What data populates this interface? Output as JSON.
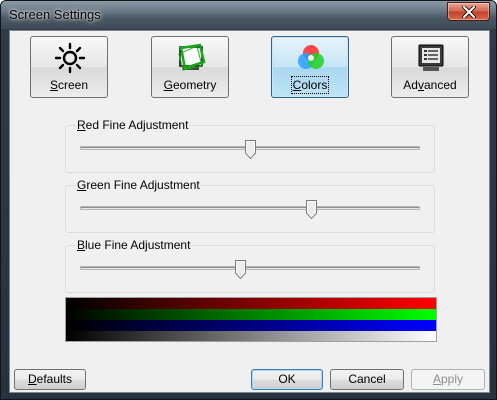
{
  "window": {
    "title": "Screen Settings"
  },
  "tabs": [
    {
      "label": "Screen",
      "mnemonic": "S",
      "rest": "creen",
      "icon": "sun-icon"
    },
    {
      "label": "Geometry",
      "mnemonic": "G",
      "rest": "eometry",
      "icon": "geometry-icon"
    },
    {
      "label": "Colors",
      "mnemonic": "C",
      "rest": "olors",
      "icon": "rgb-circles-icon",
      "active": true
    },
    {
      "label": "Advanced",
      "pre": "Ad",
      "mnemonic": "v",
      "rest": "anced",
      "icon": "monitor-settings-icon"
    }
  ],
  "sliders": {
    "red": {
      "label": "Red Fine Adjustment",
      "mnemonic": "R",
      "rest": "ed Fine Adjustment",
      "value": 0.5
    },
    "green": {
      "label": "Green Fine Adjustment",
      "mnemonic": "G",
      "rest": "reen Fine Adjustment",
      "value": 0.68
    },
    "blue": {
      "label": "Blue Fine Adjustment",
      "mnemonic": "B",
      "rest": "lue Fine Adjustment",
      "value": 0.47
    }
  },
  "gradient_bars": [
    "red",
    "green",
    "blue",
    "white"
  ],
  "buttons": {
    "defaults": {
      "label": "Defaults",
      "mnemonic": "D",
      "rest": "efaults"
    },
    "ok": {
      "label": "OK"
    },
    "cancel": {
      "label": "Cancel"
    },
    "apply": {
      "label": "Apply",
      "mnemonic": "A",
      "rest": "pply",
      "disabled": true
    }
  },
  "colors": {
    "accent_active_tab": "#a9d7f0",
    "close_button": "#c3422a"
  }
}
